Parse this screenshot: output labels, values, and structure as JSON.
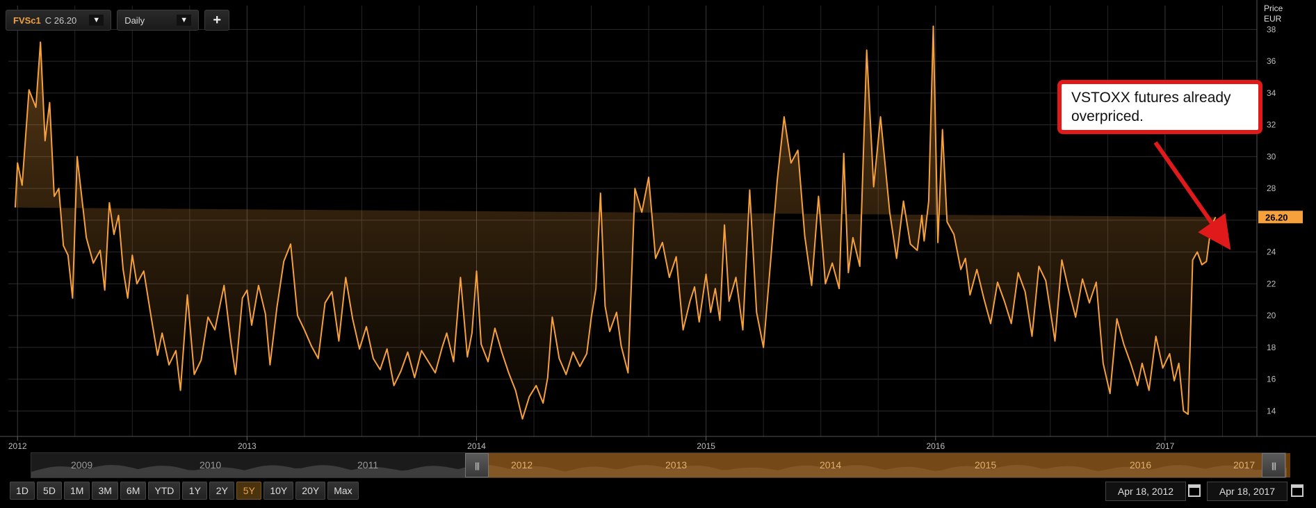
{
  "toolbar": {
    "ric": "FVSc1",
    "close_label": "C 26.20",
    "frequency": "Daily",
    "add_label": "+"
  },
  "axis": {
    "y_title": "Price",
    "y_unit": "EUR",
    "last_price_tag": "26.20"
  },
  "annotation": {
    "text": "VSTOXX futures already overpriced."
  },
  "navigator": {
    "labels": [
      "2009",
      "2010",
      "2011",
      "2012",
      "2013",
      "2014",
      "2015",
      "2016",
      "2017"
    ],
    "handle_glyph": "|||"
  },
  "range_buttons": [
    "1D",
    "5D",
    "1M",
    "3M",
    "6M",
    "YTD",
    "1Y",
    "2Y",
    "5Y",
    "10Y",
    "20Y",
    "Max"
  ],
  "active_range": "5Y",
  "date_range": {
    "start": "Apr 18, 2012",
    "end": "Apr 18, 2017"
  },
  "colors": {
    "line": "#f7a13d",
    "background": "#000000",
    "grid": "#2c2c2c",
    "callout_border": "#e01a1a",
    "arrow": "#e01a1a"
  },
  "chart_data": {
    "type": "area",
    "series": [
      {
        "values_x": [
          2011.99,
          2012.0,
          2012.02,
          2012.05,
          2012.08,
          2012.1,
          2012.12,
          2012.14,
          2012.16,
          2012.18,
          2012.2,
          2012.22,
          2012.24,
          2012.26,
          2012.3,
          2012.33,
          2012.36,
          2012.38,
          2012.4,
          2012.42,
          2012.44,
          2012.46,
          2012.48,
          2012.5,
          2012.52,
          2012.55,
          2012.58,
          2012.61,
          2012.63,
          2012.66,
          2012.69,
          2012.71,
          2012.74,
          2012.77,
          2012.8,
          2012.83,
          2012.86,
          2012.9,
          2012.93,
          2012.95,
          2012.98,
          2013.0,
          2013.02,
          2013.05,
          2013.08,
          2013.1,
          2013.13,
          2013.16,
          2013.19,
          2013.22,
          2013.25,
          2013.28,
          2013.31,
          2013.34,
          2013.37,
          2013.4,
          2013.43,
          2013.46,
          2013.49,
          2013.52,
          2013.55,
          2013.58,
          2013.61,
          2013.64,
          2013.67,
          2013.7,
          2013.73,
          2013.76,
          2013.79,
          2013.82,
          2013.85,
          2013.87,
          2013.9,
          2013.93,
          2013.96,
          2013.98,
          2014.0,
          2014.02,
          2014.05,
          2014.08,
          2014.11,
          2014.14,
          2014.17,
          2014.2,
          2014.23,
          2014.26,
          2014.29,
          2014.31,
          2014.33,
          2014.36,
          2014.39,
          2014.42,
          2014.45,
          2014.48,
          2014.5,
          2014.52,
          2014.54,
          2014.56,
          2014.58,
          2014.61,
          2014.63,
          2014.66,
          2014.69,
          2014.72,
          2014.75,
          2014.78,
          2014.81,
          2014.84,
          2014.87,
          2014.9,
          2014.93,
          2014.95,
          2014.97,
          2015.0,
          2015.02,
          2015.04,
          2015.06,
          2015.08,
          2015.1,
          2015.13,
          2015.16,
          2015.19,
          2015.22,
          2015.25,
          2015.28,
          2015.31,
          2015.34,
          2015.37,
          2015.4,
          2015.43,
          2015.46,
          2015.49,
          2015.52,
          2015.55,
          2015.58,
          2015.6,
          2015.62,
          2015.64,
          2015.67,
          2015.7,
          2015.73,
          2015.76,
          2015.8,
          2015.83,
          2015.86,
          2015.89,
          2015.92,
          2015.94,
          2015.95,
          2015.97,
          2015.99,
          2016.01,
          2016.03,
          2016.05,
          2016.08,
          2016.11,
          2016.13,
          2016.15,
          2016.18,
          2016.21,
          2016.24,
          2016.27,
          2016.3,
          2016.33,
          2016.36,
          2016.39,
          2016.42,
          2016.45,
          2016.48,
          2016.5,
          2016.52,
          2016.55,
          2016.58,
          2016.61,
          2016.64,
          2016.67,
          2016.7,
          2016.73,
          2016.76,
          2016.79,
          2016.82,
          2016.85,
          2016.88,
          2016.9,
          2016.93,
          2016.96,
          2016.99,
          2017.02,
          2017.04,
          2017.06,
          2017.08,
          2017.1,
          2017.12,
          2017.14,
          2017.16,
          2017.18,
          2017.2,
          2017.22,
          2017.25,
          2017.27,
          2017.29
        ],
        "values_y": [
          26.8,
          29.6,
          28.2,
          34.2,
          33.1,
          37.2,
          31.0,
          33.4,
          27.5,
          28.0,
          24.4,
          23.8,
          21.1,
          30.0,
          24.9,
          23.3,
          24.1,
          21.6,
          27.1,
          25.1,
          26.3,
          22.9,
          21.1,
          23.8,
          22.0,
          22.8,
          20.1,
          17.5,
          18.9,
          16.9,
          17.8,
          15.3,
          21.3,
          16.3,
          17.2,
          19.9,
          19.1,
          21.9,
          18.3,
          16.3,
          21.1,
          21.6,
          19.4,
          21.9,
          20.1,
          16.9,
          20.5,
          23.4,
          24.5,
          20.0,
          19.1,
          18.1,
          17.3,
          20.8,
          21.5,
          18.4,
          22.4,
          19.8,
          17.9,
          19.3,
          17.3,
          16.6,
          17.9,
          15.6,
          16.5,
          17.7,
          16.1,
          17.8,
          17.1,
          16.4,
          18.0,
          18.9,
          17.1,
          22.4,
          17.4,
          18.9,
          22.8,
          18.2,
          17.1,
          19.2,
          17.7,
          16.4,
          15.3,
          13.5,
          14.9,
          15.6,
          14.5,
          16.1,
          19.9,
          17.3,
          16.3,
          17.7,
          16.8,
          17.6,
          19.9,
          21.7,
          27.7,
          20.6,
          19.0,
          20.2,
          18.1,
          16.4,
          28.0,
          26.5,
          28.7,
          23.6,
          24.6,
          22.4,
          23.7,
          19.1,
          20.9,
          21.8,
          19.6,
          22.6,
          20.2,
          21.7,
          19.7,
          25.7,
          20.9,
          22.4,
          19.1,
          27.9,
          20.2,
          18.0,
          23.2,
          28.5,
          32.5,
          29.6,
          30.4,
          25.0,
          21.9,
          27.5,
          22.0,
          23.3,
          21.7,
          30.2,
          22.7,
          24.9,
          23.1,
          36.7,
          28.1,
          32.5,
          26.5,
          23.6,
          27.2,
          24.5,
          24.1,
          26.3,
          24.7,
          27.2,
          38.2,
          24.6,
          31.7,
          25.9,
          25.1,
          22.9,
          23.6,
          21.3,
          22.9,
          21.1,
          19.5,
          22.1,
          20.9,
          19.5,
          22.7,
          21.5,
          18.7,
          23.1,
          22.2,
          20.3,
          18.4,
          23.5,
          21.6,
          19.9,
          22.3,
          20.8,
          22.1,
          17.0,
          15.1,
          19.8,
          18.2,
          17.0,
          15.6,
          17.0,
          15.3,
          18.7,
          16.7,
          17.6,
          15.9,
          17.0,
          14.0,
          13.8,
          23.5,
          24.0,
          23.2,
          23.4,
          25.6,
          26.2
        ]
      }
    ],
    "x_tick_labels": [
      "2012",
      "2013",
      "2014",
      "2015",
      "2016",
      "2017"
    ],
    "x_tick_values": [
      2012.0,
      2013.0,
      2014.0,
      2015.0,
      2016.0,
      2017.0
    ],
    "y_ticks": [
      14,
      16,
      18,
      20,
      22,
      24,
      26,
      28,
      30,
      32,
      34,
      36,
      38
    ],
    "xlim": [
      2011.96,
      2017.4
    ],
    "ylim": [
      12.4,
      39.5
    ],
    "y_axis_side": "right",
    "grid": true,
    "last_value": 26.2
  }
}
